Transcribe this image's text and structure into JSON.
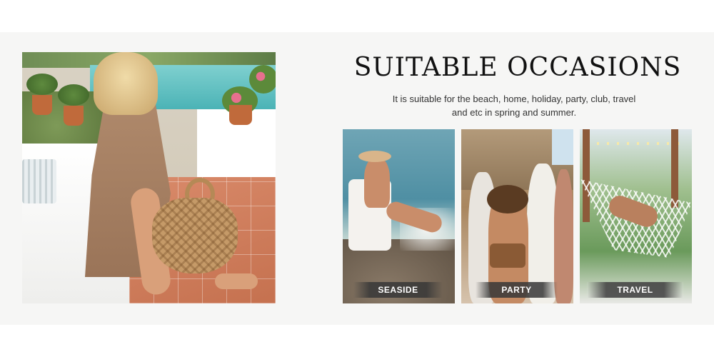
{
  "section": {
    "title": "SUITABLE OCCASIONS",
    "subtitle_line1": "It is suitable for the beach, home, holiday, party, club, travel",
    "subtitle_line2": "and etc in spring and summer."
  },
  "occasions": [
    {
      "label": "SEASIDE"
    },
    {
      "label": "PARTY"
    },
    {
      "label": "TRAVEL"
    }
  ],
  "colors": {
    "band_background": "#f6f6f5",
    "heading_text": "#111111",
    "label_text": "#ffffff"
  }
}
